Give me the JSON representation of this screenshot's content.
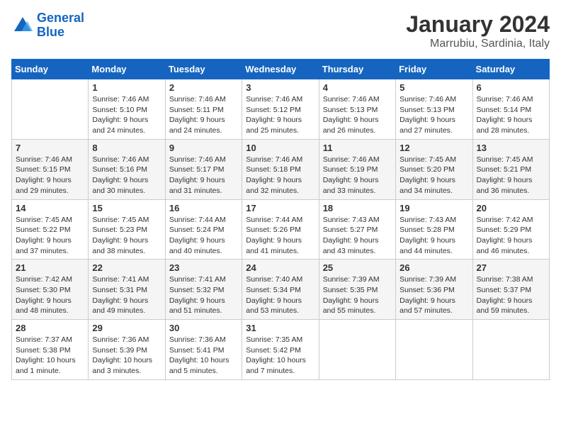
{
  "header": {
    "logo_line1": "General",
    "logo_line2": "Blue",
    "month": "January 2024",
    "location": "Marrubiu, Sardinia, Italy"
  },
  "days_of_week": [
    "Sunday",
    "Monday",
    "Tuesday",
    "Wednesday",
    "Thursday",
    "Friday",
    "Saturday"
  ],
  "weeks": [
    [
      {
        "day": "",
        "sunrise": "",
        "sunset": "",
        "daylight": ""
      },
      {
        "day": "1",
        "sunrise": "Sunrise: 7:46 AM",
        "sunset": "Sunset: 5:10 PM",
        "daylight": "Daylight: 9 hours and 24 minutes."
      },
      {
        "day": "2",
        "sunrise": "Sunrise: 7:46 AM",
        "sunset": "Sunset: 5:11 PM",
        "daylight": "Daylight: 9 hours and 24 minutes."
      },
      {
        "day": "3",
        "sunrise": "Sunrise: 7:46 AM",
        "sunset": "Sunset: 5:12 PM",
        "daylight": "Daylight: 9 hours and 25 minutes."
      },
      {
        "day": "4",
        "sunrise": "Sunrise: 7:46 AM",
        "sunset": "Sunset: 5:13 PM",
        "daylight": "Daylight: 9 hours and 26 minutes."
      },
      {
        "day": "5",
        "sunrise": "Sunrise: 7:46 AM",
        "sunset": "Sunset: 5:13 PM",
        "daylight": "Daylight: 9 hours and 27 minutes."
      },
      {
        "day": "6",
        "sunrise": "Sunrise: 7:46 AM",
        "sunset": "Sunset: 5:14 PM",
        "daylight": "Daylight: 9 hours and 28 minutes."
      }
    ],
    [
      {
        "day": "7",
        "sunrise": "Sunrise: 7:46 AM",
        "sunset": "Sunset: 5:15 PM",
        "daylight": "Daylight: 9 hours and 29 minutes."
      },
      {
        "day": "8",
        "sunrise": "Sunrise: 7:46 AM",
        "sunset": "Sunset: 5:16 PM",
        "daylight": "Daylight: 9 hours and 30 minutes."
      },
      {
        "day": "9",
        "sunrise": "Sunrise: 7:46 AM",
        "sunset": "Sunset: 5:17 PM",
        "daylight": "Daylight: 9 hours and 31 minutes."
      },
      {
        "day": "10",
        "sunrise": "Sunrise: 7:46 AM",
        "sunset": "Sunset: 5:18 PM",
        "daylight": "Daylight: 9 hours and 32 minutes."
      },
      {
        "day": "11",
        "sunrise": "Sunrise: 7:46 AM",
        "sunset": "Sunset: 5:19 PM",
        "daylight": "Daylight: 9 hours and 33 minutes."
      },
      {
        "day": "12",
        "sunrise": "Sunrise: 7:45 AM",
        "sunset": "Sunset: 5:20 PM",
        "daylight": "Daylight: 9 hours and 34 minutes."
      },
      {
        "day": "13",
        "sunrise": "Sunrise: 7:45 AM",
        "sunset": "Sunset: 5:21 PM",
        "daylight": "Daylight: 9 hours and 36 minutes."
      }
    ],
    [
      {
        "day": "14",
        "sunrise": "Sunrise: 7:45 AM",
        "sunset": "Sunset: 5:22 PM",
        "daylight": "Daylight: 9 hours and 37 minutes."
      },
      {
        "day": "15",
        "sunrise": "Sunrise: 7:45 AM",
        "sunset": "Sunset: 5:23 PM",
        "daylight": "Daylight: 9 hours and 38 minutes."
      },
      {
        "day": "16",
        "sunrise": "Sunrise: 7:44 AM",
        "sunset": "Sunset: 5:24 PM",
        "daylight": "Daylight: 9 hours and 40 minutes."
      },
      {
        "day": "17",
        "sunrise": "Sunrise: 7:44 AM",
        "sunset": "Sunset: 5:26 PM",
        "daylight": "Daylight: 9 hours and 41 minutes."
      },
      {
        "day": "18",
        "sunrise": "Sunrise: 7:43 AM",
        "sunset": "Sunset: 5:27 PM",
        "daylight": "Daylight: 9 hours and 43 minutes."
      },
      {
        "day": "19",
        "sunrise": "Sunrise: 7:43 AM",
        "sunset": "Sunset: 5:28 PM",
        "daylight": "Daylight: 9 hours and 44 minutes."
      },
      {
        "day": "20",
        "sunrise": "Sunrise: 7:42 AM",
        "sunset": "Sunset: 5:29 PM",
        "daylight": "Daylight: 9 hours and 46 minutes."
      }
    ],
    [
      {
        "day": "21",
        "sunrise": "Sunrise: 7:42 AM",
        "sunset": "Sunset: 5:30 PM",
        "daylight": "Daylight: 9 hours and 48 minutes."
      },
      {
        "day": "22",
        "sunrise": "Sunrise: 7:41 AM",
        "sunset": "Sunset: 5:31 PM",
        "daylight": "Daylight: 9 hours and 49 minutes."
      },
      {
        "day": "23",
        "sunrise": "Sunrise: 7:41 AM",
        "sunset": "Sunset: 5:32 PM",
        "daylight": "Daylight: 9 hours and 51 minutes."
      },
      {
        "day": "24",
        "sunrise": "Sunrise: 7:40 AM",
        "sunset": "Sunset: 5:34 PM",
        "daylight": "Daylight: 9 hours and 53 minutes."
      },
      {
        "day": "25",
        "sunrise": "Sunrise: 7:39 AM",
        "sunset": "Sunset: 5:35 PM",
        "daylight": "Daylight: 9 hours and 55 minutes."
      },
      {
        "day": "26",
        "sunrise": "Sunrise: 7:39 AM",
        "sunset": "Sunset: 5:36 PM",
        "daylight": "Daylight: 9 hours and 57 minutes."
      },
      {
        "day": "27",
        "sunrise": "Sunrise: 7:38 AM",
        "sunset": "Sunset: 5:37 PM",
        "daylight": "Daylight: 9 hours and 59 minutes."
      }
    ],
    [
      {
        "day": "28",
        "sunrise": "Sunrise: 7:37 AM",
        "sunset": "Sunset: 5:38 PM",
        "daylight": "Daylight: 10 hours and 1 minute."
      },
      {
        "day": "29",
        "sunrise": "Sunrise: 7:36 AM",
        "sunset": "Sunset: 5:39 PM",
        "daylight": "Daylight: 10 hours and 3 minutes."
      },
      {
        "day": "30",
        "sunrise": "Sunrise: 7:36 AM",
        "sunset": "Sunset: 5:41 PM",
        "daylight": "Daylight: 10 hours and 5 minutes."
      },
      {
        "day": "31",
        "sunrise": "Sunrise: 7:35 AM",
        "sunset": "Sunset: 5:42 PM",
        "daylight": "Daylight: 10 hours and 7 minutes."
      },
      {
        "day": "",
        "sunrise": "",
        "sunset": "",
        "daylight": ""
      },
      {
        "day": "",
        "sunrise": "",
        "sunset": "",
        "daylight": ""
      },
      {
        "day": "",
        "sunrise": "",
        "sunset": "",
        "daylight": ""
      }
    ]
  ]
}
